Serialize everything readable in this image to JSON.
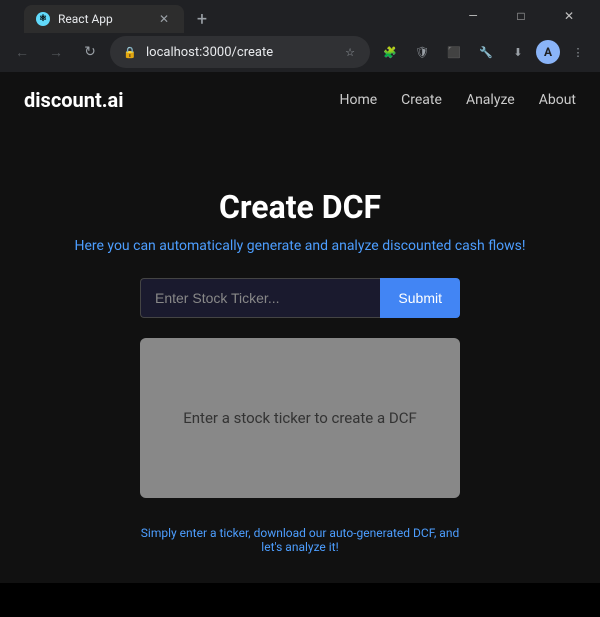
{
  "browser": {
    "tab_title": "React App",
    "new_tab_icon": "+",
    "url": "localhost:3000/create",
    "window_min": "—",
    "window_max": "□",
    "window_close": "✕",
    "nav_back": "←",
    "nav_forward": "→",
    "nav_refresh": "↻"
  },
  "navbar": {
    "logo": "discount.ai",
    "links": [
      {
        "label": "Home",
        "href": "#"
      },
      {
        "label": "Create",
        "href": "#"
      },
      {
        "label": "Analyze",
        "href": "#"
      },
      {
        "label": "About",
        "href": "#"
      }
    ]
  },
  "main": {
    "title": "Create DCF",
    "subtitle": "Here you can automatically generate and analyze discounted cash flows!",
    "input_placeholder": "Enter Stock Ticker...",
    "submit_label": "Submit",
    "placeholder_box_text": "Enter a stock ticker to create a DCF",
    "footer_hint": "Simply enter a ticker, download our auto-generated DCF, and let's analyze it!"
  }
}
